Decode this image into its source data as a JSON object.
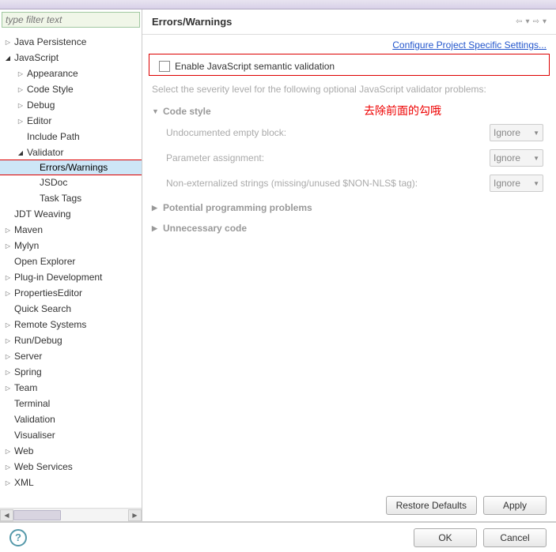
{
  "filter": {
    "placeholder": "type filter text"
  },
  "tree": [
    {
      "label": "Java Persistence",
      "level": 0,
      "arrow": "▷"
    },
    {
      "label": "JavaScript",
      "level": 0,
      "arrow": "◢"
    },
    {
      "label": "Appearance",
      "level": 1,
      "arrow": "▷"
    },
    {
      "label": "Code Style",
      "level": 1,
      "arrow": "▷"
    },
    {
      "label": "Debug",
      "level": 1,
      "arrow": "▷"
    },
    {
      "label": "Editor",
      "level": 1,
      "arrow": "▷"
    },
    {
      "label": "Include Path",
      "level": 1,
      "arrow": ""
    },
    {
      "label": "Validator",
      "level": 1,
      "arrow": "◢"
    },
    {
      "label": "Errors/Warnings",
      "level": 2,
      "arrow": "",
      "selected": true
    },
    {
      "label": "JSDoc",
      "level": 2,
      "arrow": ""
    },
    {
      "label": "Task Tags",
      "level": 2,
      "arrow": ""
    },
    {
      "label": "JDT Weaving",
      "level": 0,
      "arrow": ""
    },
    {
      "label": "Maven",
      "level": 0,
      "arrow": "▷"
    },
    {
      "label": "Mylyn",
      "level": 0,
      "arrow": "▷"
    },
    {
      "label": "Open Explorer",
      "level": 0,
      "arrow": ""
    },
    {
      "label": "Plug-in Development",
      "level": 0,
      "arrow": "▷"
    },
    {
      "label": "PropertiesEditor",
      "level": 0,
      "arrow": "▷"
    },
    {
      "label": "Quick Search",
      "level": 0,
      "arrow": ""
    },
    {
      "label": "Remote Systems",
      "level": 0,
      "arrow": "▷"
    },
    {
      "label": "Run/Debug",
      "level": 0,
      "arrow": "▷"
    },
    {
      "label": "Server",
      "level": 0,
      "arrow": "▷"
    },
    {
      "label": "Spring",
      "level": 0,
      "arrow": "▷"
    },
    {
      "label": "Team",
      "level": 0,
      "arrow": "▷"
    },
    {
      "label": "Terminal",
      "level": 0,
      "arrow": ""
    },
    {
      "label": "Validation",
      "level": 0,
      "arrow": ""
    },
    {
      "label": "Visualiser",
      "level": 0,
      "arrow": ""
    },
    {
      "label": "Web",
      "level": 0,
      "arrow": "▷"
    },
    {
      "label": "Web Services",
      "level": 0,
      "arrow": "▷"
    },
    {
      "label": "XML",
      "level": 0,
      "arrow": "▷"
    }
  ],
  "header": {
    "title": "Errors/Warnings"
  },
  "nav": {
    "back": "⇦",
    "back_drop": "▾",
    "fwd": "⇨",
    "fwd_drop": "▾"
  },
  "link": "Configure Project Specific Settings...",
  "checkbox": {
    "label": "Enable JavaScript semantic validation",
    "checked": false
  },
  "desc": "Select the severity level for the following optional JavaScript validator problems:",
  "annotation": "去除前面的勾哦",
  "sections": {
    "codestyle": {
      "title": "Code style",
      "expanded": true
    },
    "potential": {
      "title": "Potential programming problems",
      "expanded": false
    },
    "unnecessary": {
      "title": "Unnecessary code",
      "expanded": false
    }
  },
  "options": [
    {
      "label": "Undocumented empty block:",
      "value": "Ignore"
    },
    {
      "label": "Parameter assignment:",
      "value": "Ignore"
    },
    {
      "label": "Non-externalized strings (missing/unused $NON-NLS$ tag):",
      "value": "Ignore"
    }
  ],
  "buttons": {
    "restore": "Restore Defaults",
    "apply": "Apply",
    "ok": "OK",
    "cancel": "Cancel"
  }
}
